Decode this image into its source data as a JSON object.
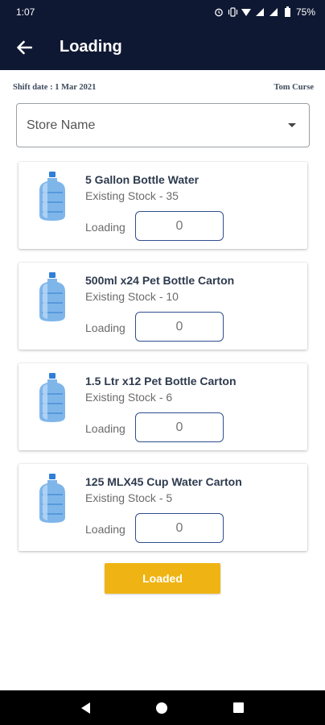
{
  "status_bar": {
    "time": "1:07",
    "battery": "75%"
  },
  "app_bar": {
    "title": "Loading"
  },
  "shift": {
    "date_label": "Shift date : 1 Mar 2021",
    "user": "Tom Curse"
  },
  "store_select": {
    "label": "Store Name"
  },
  "products": [
    {
      "name": "5 Gallon Bottle Water",
      "stock": "Existing Stock - 35",
      "loading_label": "Loading",
      "quantity": "",
      "placeholder": "0"
    },
    {
      "name": "500ml x24 Pet Bottle Carton",
      "stock": "Existing Stock - 10",
      "loading_label": "Loading",
      "quantity": "",
      "placeholder": "0"
    },
    {
      "name": "1.5 Ltr x12 Pet Bottle Carton",
      "stock": "Existing Stock - 6",
      "loading_label": "Loading",
      "quantity": "",
      "placeholder": "0"
    },
    {
      "name": "125 MLX45 Cup Water Carton",
      "stock": "Existing Stock - 5",
      "loading_label": "Loading",
      "quantity": "",
      "placeholder": "0"
    }
  ],
  "actions": {
    "loaded_label": "Loaded"
  },
  "icons": {
    "back": "arrow-left-icon",
    "dropdown": "caret-down-icon",
    "product": "water-bottle-icon",
    "nav": [
      "nav-back-icon",
      "nav-home-icon",
      "nav-recent-icon"
    ]
  },
  "colors": {
    "app_bar": "#0f1833",
    "accent_button": "#efb414",
    "input_border": "#2f4f8f"
  }
}
